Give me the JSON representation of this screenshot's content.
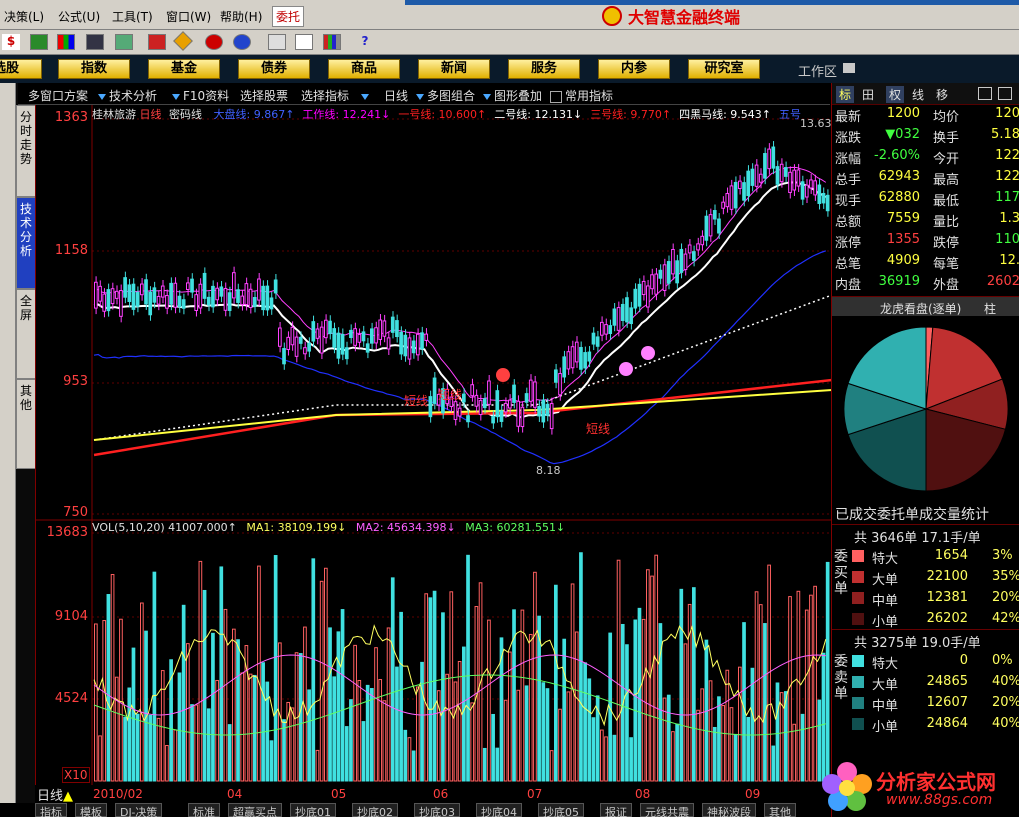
{
  "menu": {
    "items": [
      "决策(L)",
      "公式(U)",
      "工具(T)",
      "窗口(W)",
      "帮助(H)"
    ],
    "entrust": "委托",
    "brand": "大智慧金融终端"
  },
  "nav": {
    "buttons": [
      "选股",
      "指数",
      "基金",
      "债券",
      "商品",
      "新闻",
      "服务",
      "内参",
      "研究室"
    ],
    "workarea": "工作区"
  },
  "tools": {
    "items": [
      "多窗口方案",
      "技术分析",
      "F10资料",
      "选择股票",
      "选择指标",
      "日线",
      "多图组合",
      "图形叠加",
      "常用指标"
    ]
  },
  "sidetabs": [
    "分时走势",
    "技术分析",
    "全屏",
    "其他"
  ],
  "chart": {
    "stock_name": "桂林旅游",
    "period": "日线",
    "indicator": "密码线",
    "lines": [
      {
        "name": "大盘线",
        "value": "9.867↑",
        "color": "#4060ff"
      },
      {
        "name": "工作线",
        "value": "12.241↓",
        "color": "#ff00ff"
      },
      {
        "name": "一号线",
        "value": "10.600↑",
        "color": "#ff2020"
      },
      {
        "name": "二号线",
        "value": "12.131↓",
        "color": "#ffffff"
      },
      {
        "name": "三号线",
        "value": "9.770↑",
        "color": "#ff2020"
      },
      {
        "name": "四黑马线",
        "value": "9.543↑",
        "color": "#ffffff"
      },
      {
        "name": "五号",
        "value": "",
        "color": "#4060ff"
      }
    ],
    "price_axis": [
      "1363",
      "1158",
      "953",
      "750"
    ],
    "high_label": "13.63",
    "low_label": "8.18",
    "short_line_label": "短线",
    "vol_header": {
      "vol": "VOL(5,10,20) 41007.000↑",
      "ma1": "MA1: 38109.199↓",
      "ma2": "MA2: 45634.398↓",
      "ma3": "MA3: 60281.551↓"
    },
    "vol_axis": [
      "13683",
      "9104",
      "4524"
    ],
    "vol_unit": "X10"
  },
  "dates": [
    "2010/02",
    "04",
    "05",
    "06",
    "07",
    "08",
    "09"
  ],
  "bottom": {
    "period_label": "日线",
    "tabs": [
      "指标",
      "模板",
      "DJ-决策",
      "标准",
      "超赢买点",
      "抄底01",
      "抄底02",
      "抄底03",
      "抄底04",
      "抄底05",
      "报证",
      "元线共震",
      "神秘波段",
      "其他"
    ]
  },
  "quote": {
    "tabs": [
      "标",
      "田",
      "权",
      "线",
      "移"
    ],
    "rows": [
      {
        "l": "最新",
        "v": "1200",
        "vc": "#ffff40",
        "l2": "均价",
        "v2": "120",
        "v2c": "#ffff40"
      },
      {
        "l": "涨跌",
        "v": "▼032",
        "vc": "#40ff40",
        "l2": "换手",
        "v2": "5.18",
        "v2c": "#ffff40"
      },
      {
        "l": "涨幅",
        "v": "-2.60%",
        "vc": "#40ff40",
        "l2": "今开",
        "v2": "122",
        "v2c": "#ffff40"
      },
      {
        "l": "总手",
        "v": "62943",
        "vc": "#ffff40",
        "l2": "最高",
        "v2": "122",
        "v2c": "#ffff40"
      },
      {
        "l": "现手",
        "v": "62880",
        "vc": "#ffff40",
        "l2": "最低",
        "v2": "117",
        "v2c": "#40ff40"
      },
      {
        "l": "总额",
        "v": "7559",
        "vc": "#ffff40",
        "l2": "量比",
        "v2": "1.3",
        "v2c": "#ffff40"
      },
      {
        "l": "涨停",
        "v": "1355",
        "vc": "#ff4040",
        "l2": "跌停",
        "v2": "110",
        "v2c": "#40ff40"
      },
      {
        "l": "总笔",
        "v": "4909",
        "vc": "#ffff40",
        "l2": "每笔",
        "v2": "12.",
        "v2c": "#ffff40"
      },
      {
        "l": "内盘",
        "v": "36919",
        "vc": "#40ff40",
        "l2": "外盘",
        "v2": "2602",
        "v2c": "#ff4040"
      }
    ],
    "dragon_tab": "龙虎看盘(逐单)",
    "dragon_tab2": "柱",
    "stats_title": "已成交委托单成交量统计",
    "buy": {
      "summary": "共 3646单 17.1手/单",
      "side_label": "委买单",
      "rows": [
        {
          "label": "特大",
          "value": "1654",
          "pct": "3%",
          "color": "#ff6060"
        },
        {
          "label": "大单",
          "value": "22100",
          "pct": "35%",
          "color": "#c03030"
        },
        {
          "label": "中单",
          "value": "12381",
          "pct": "20%",
          "color": "#902020"
        },
        {
          "label": "小单",
          "value": "26202",
          "pct": "42%",
          "color": "#501010"
        }
      ]
    },
    "sell": {
      "summary": "共 3275单 19.0手/单",
      "side_label": "委卖单",
      "rows": [
        {
          "label": "特大",
          "value": "0",
          "pct": "0%",
          "color": "#40e0e0"
        },
        {
          "label": "大单",
          "value": "24865",
          "pct": "40%",
          "color": "#30b0b0"
        },
        {
          "label": "中单",
          "value": "12607",
          "pct": "20%",
          "color": "#208080"
        },
        {
          "label": "小单",
          "value": "24864",
          "pct": "40%",
          "color": "#105050"
        }
      ]
    }
  },
  "watermark": {
    "text": "分析家公式网",
    "url": "www.88gs.com"
  }
}
